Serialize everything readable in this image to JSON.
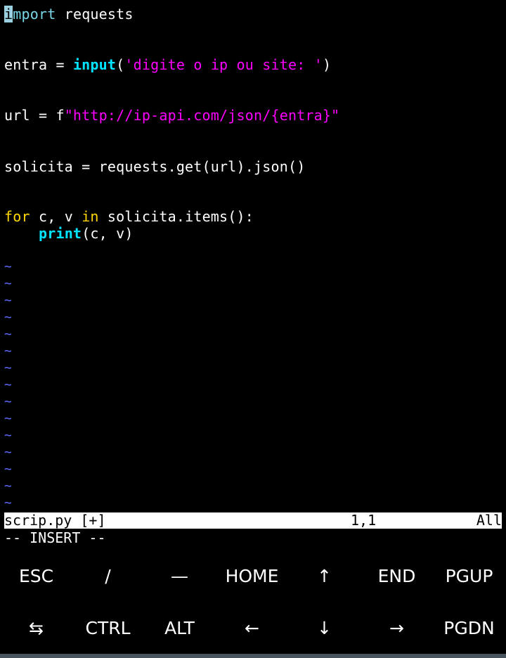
{
  "code": {
    "l1_cursor": "i",
    "l1_kw_rest": "mport",
    "l1_rest": " requests",
    "l2_a": "entra = ",
    "l2_fn": "input",
    "l2_b": "(",
    "l2_str": "'digite o ip ou site: '",
    "l2_c": ")",
    "l3_a": "url = f",
    "l3_str": "\"http://ip-api.com/json/{entra}\"",
    "l4": "solicita = requests.get(url).json()",
    "l5_kw": "for",
    "l5_a": " c, v ",
    "l5_in": "in",
    "l5_b": " solicita.items():",
    "l6_indent": "    ",
    "l6_fn": "print",
    "l6_b": "(c, v)"
  },
  "tilde": "~",
  "status": {
    "filename": "scrip.py [+]",
    "position": "1,1",
    "scroll": "All"
  },
  "mode": "-- INSERT --",
  "keys_row1": [
    "ESC",
    "/",
    "—",
    "HOME",
    "↑",
    "END",
    "PGUP"
  ],
  "keys_row2": [
    "⇆",
    "CTRL",
    "ALT",
    "←",
    "↓",
    "→",
    "PGDN"
  ],
  "colors": {
    "background": "#000000",
    "keyword": "#ffd700",
    "builtin": "#00e5ff",
    "string": "#ff00ff",
    "tilde": "#5b6dff",
    "statusbar": "#ffffff"
  }
}
